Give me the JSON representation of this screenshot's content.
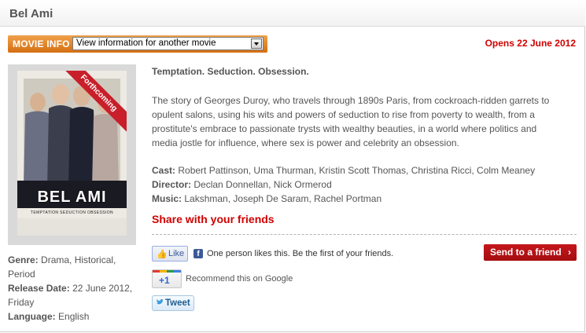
{
  "header": {
    "title": "Bel Ami"
  },
  "movie_info": {
    "label": "MOVIE INFO",
    "select_value": "View information for another movie"
  },
  "opens": "Opens 22 June 2012",
  "poster": {
    "ribbon": "Forthcoming",
    "title": "BEL AMI",
    "tagline": "TEMPTATION SEDUCTION OBSESSION"
  },
  "details": {
    "genre_label": "Genre:",
    "genre_value": "Drama, Historical, Period",
    "release_label": "Release Date:",
    "release_value": "22 June 2012, Friday",
    "language_label": "Language:",
    "language_value": "English"
  },
  "content": {
    "tagline": "Temptation. Seduction. Obsession.",
    "synopsis": "The story of Georges Duroy, who travels through 1890s Paris, from cockroach-ridden garrets to opulent salons, using his wits and powers of seduction to rise from poverty to wealth, from a prostitute's embrace to passionate trysts with wealthy beauties, in a world where politics and media jostle for influence, where sex is power and celebrity an obsession.",
    "cast_label": "Cast:",
    "cast_value": "Robert Pattinson, Uma Thurman, Kristin Scott Thomas, Christina Ricci, Colm Meaney",
    "director_label": "Director:",
    "director_value": "Declan Donnellan, Nick Ormerod",
    "music_label": "Music:",
    "music_value": "Lakshman, Joseph De Saram, Rachel Portman"
  },
  "share": {
    "title": "Share with your friends",
    "like_label": "Like",
    "like_text": "One person likes this. Be the first of your friends.",
    "send_label": "Send to a friend",
    "gplus_label": "+1",
    "gplus_text": "Recommend this on Google",
    "tweet_label": "Tweet"
  },
  "colors": {
    "accent_red": "#d10000",
    "orange_bar": "#e0821f",
    "send_button": "#b51217"
  }
}
